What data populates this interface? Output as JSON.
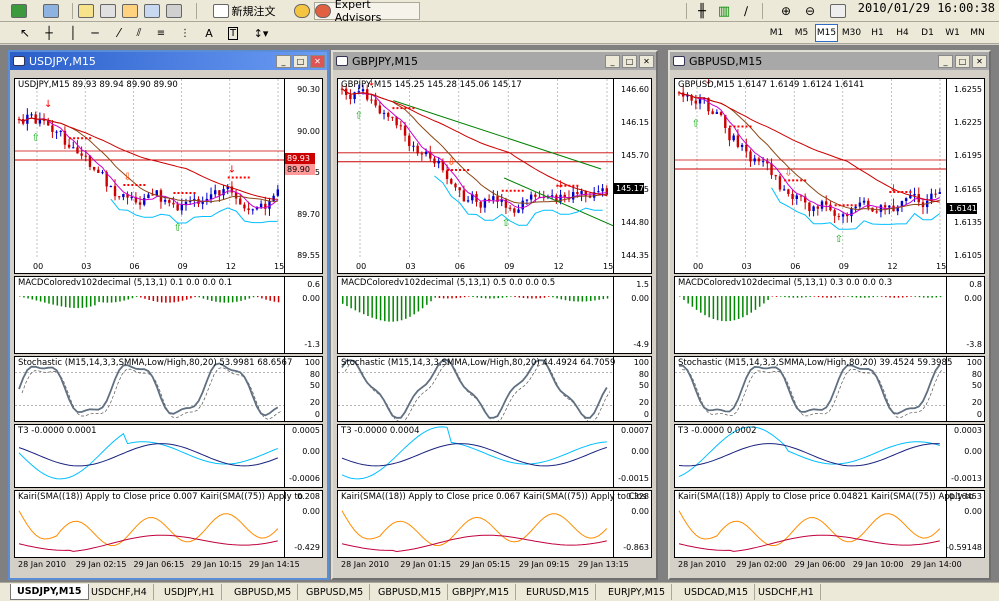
{
  "toolbar": {
    "new_order": "新規注文",
    "expert_advisors": "Expert Advisors",
    "timeframes": [
      "M1",
      "M5",
      "M15",
      "M30",
      "H1",
      "H4",
      "D1",
      "W1",
      "MN"
    ],
    "selected_timeframe": "M15",
    "datetime": "2010/01/29 16:00:38"
  },
  "windows": [
    {
      "title": "USDJPY,M15",
      "active": true,
      "header": "USDJPY,M15  89.93 89.94 89.90 89.90",
      "price_ticks": [
        "90.30",
        "90.00",
        "89.85",
        "89.70",
        "89.55"
      ],
      "price_box": "89.93",
      "price_box2": "89.90",
      "hour_labels": [
        "00",
        "03",
        "06",
        "09",
        "12",
        "15"
      ],
      "macd_label": "MACDColoredv102decimal (5,13,1) 0.1 0.0 0.0 0.1",
      "macd_ticks": [
        "0.6",
        "0.00",
        "-1.3"
      ],
      "stoch_label": "Stochastic (M15,14,3,3,SMMA,Low/High,80,20) 53.9981 68.6567",
      "stoch_ticks": [
        "100",
        "80",
        "50",
        "20",
        "0"
      ],
      "t3_label": "T3 -0.0000 0.0001",
      "t3_ticks": [
        "0.0005",
        "0.00",
        "-0.0006"
      ],
      "kairi_label": "Kairi(SMA((18)) Apply to Close price 0.007  Kairi(SMA((75)) Apply to",
      "kairi_ticks": [
        "0.208",
        "0.00",
        "-0.429"
      ],
      "date_labels": [
        "28 Jan 2010",
        "29 Jan 02:15",
        "29 Jan 06:15",
        "29 Jan 10:15",
        "29 Jan 14:15"
      ]
    },
    {
      "title": "GBPJPY,M15",
      "active": false,
      "header": "GBPJPY,M15  145.25 145.28 145.06 145.17",
      "price_ticks": [
        "146.60",
        "146.15",
        "145.70",
        "145.25",
        "144.80",
        "144.35"
      ],
      "price_box": "145.17",
      "price_box2": "",
      "hour_labels": [
        "00",
        "03",
        "06",
        "09",
        "12",
        "15"
      ],
      "macd_label": "MACDColoredv102decimal (5,13,1) 0.5 0.0 0.0 0.5",
      "macd_ticks": [
        "1.5",
        "0.00",
        "-4.9"
      ],
      "stoch_label": "Stochastic (M15,14,3,3,SMMA,Low/High,80,20) 44.4924 64.7059",
      "stoch_ticks": [
        "100",
        "80",
        "50",
        "20",
        "0"
      ],
      "t3_label": "T3 -0.0000 0.0004",
      "t3_ticks": [
        "0.0007",
        "0.00",
        "-0.0015"
      ],
      "kairi_label": "Kairi(SMA((18)) Apply to Close price 0.067  Kairi(SMA((75)) Apply to Clos",
      "kairi_ticks": [
        "0.328",
        "0.00",
        "-0.863"
      ],
      "date_labels": [
        "28 Jan 2010",
        "29 Jan 01:15",
        "29 Jan 05:15",
        "29 Jan 09:15",
        "29 Jan 13:15"
      ]
    },
    {
      "title": "GBPUSD,M15",
      "active": false,
      "header": "GBPUSD,M15  1.6147 1.6149 1.6124 1.6141",
      "price_ticks": [
        "1.6255",
        "1.6225",
        "1.6195",
        "1.6165",
        "1.6135",
        "1.6105"
      ],
      "price_box": "1.6141",
      "price_box2": "",
      "hour_labels": [
        "00",
        "03",
        "06",
        "09",
        "12",
        "15"
      ],
      "macd_label": "MACDColoredv102decimal (5,13,1) 0.3 0.0 0.0 0.3",
      "macd_ticks": [
        "0.8",
        "0.00",
        "-3.8"
      ],
      "stoch_label": "Stochastic (M15,14,3,3,SMMA,Low/High,80,20) 39.4524 59.3985",
      "stoch_ticks": [
        "100",
        "80",
        "50",
        "20",
        "0"
      ],
      "t3_label": "T3 -0.0000 0.0002",
      "t3_ticks": [
        "0.0003",
        "0.00",
        "-0.0013"
      ],
      "kairi_label": "Kairi(SMA((18)) Apply to Close price 0.04821  Kairi(SMA((75)) Apply to",
      "kairi_ticks": [
        "0.16453",
        "0.00",
        "-0.59148"
      ],
      "date_labels": [
        "28 Jan 2010",
        "29 Jan 02:00",
        "29 Jan 06:00",
        "29 Jan 10:00",
        "29 Jan 14:00"
      ]
    }
  ],
  "tabs": [
    "USDJPY,M15",
    "USDCHF,H4",
    "USDJPY,H1",
    "GBPUSD,M5",
    "GBPUSD,M5",
    "GBPUSD,M15",
    "GBPJPY,M15",
    "EURUSD,M15",
    "EURJPY,M15",
    "USDCAD,M15",
    "USDCHF,H1"
  ],
  "selected_tab": "USDJPY,M15",
  "colors": {
    "bull": "#0000cc",
    "bear": "#cc0000",
    "ma_red": "#cc0000",
    "ma_magenta": "#cc00cc",
    "ma_brown": "#8b4513",
    "ma_green": "#008000",
    "cyan": "#00bfff",
    "stoch_gray": "#607080",
    "kairi_orange": "#ff8c00",
    "kairi_crimson": "#c0003c",
    "price_box": "#000000",
    "price_box_red": "#cc0000"
  }
}
